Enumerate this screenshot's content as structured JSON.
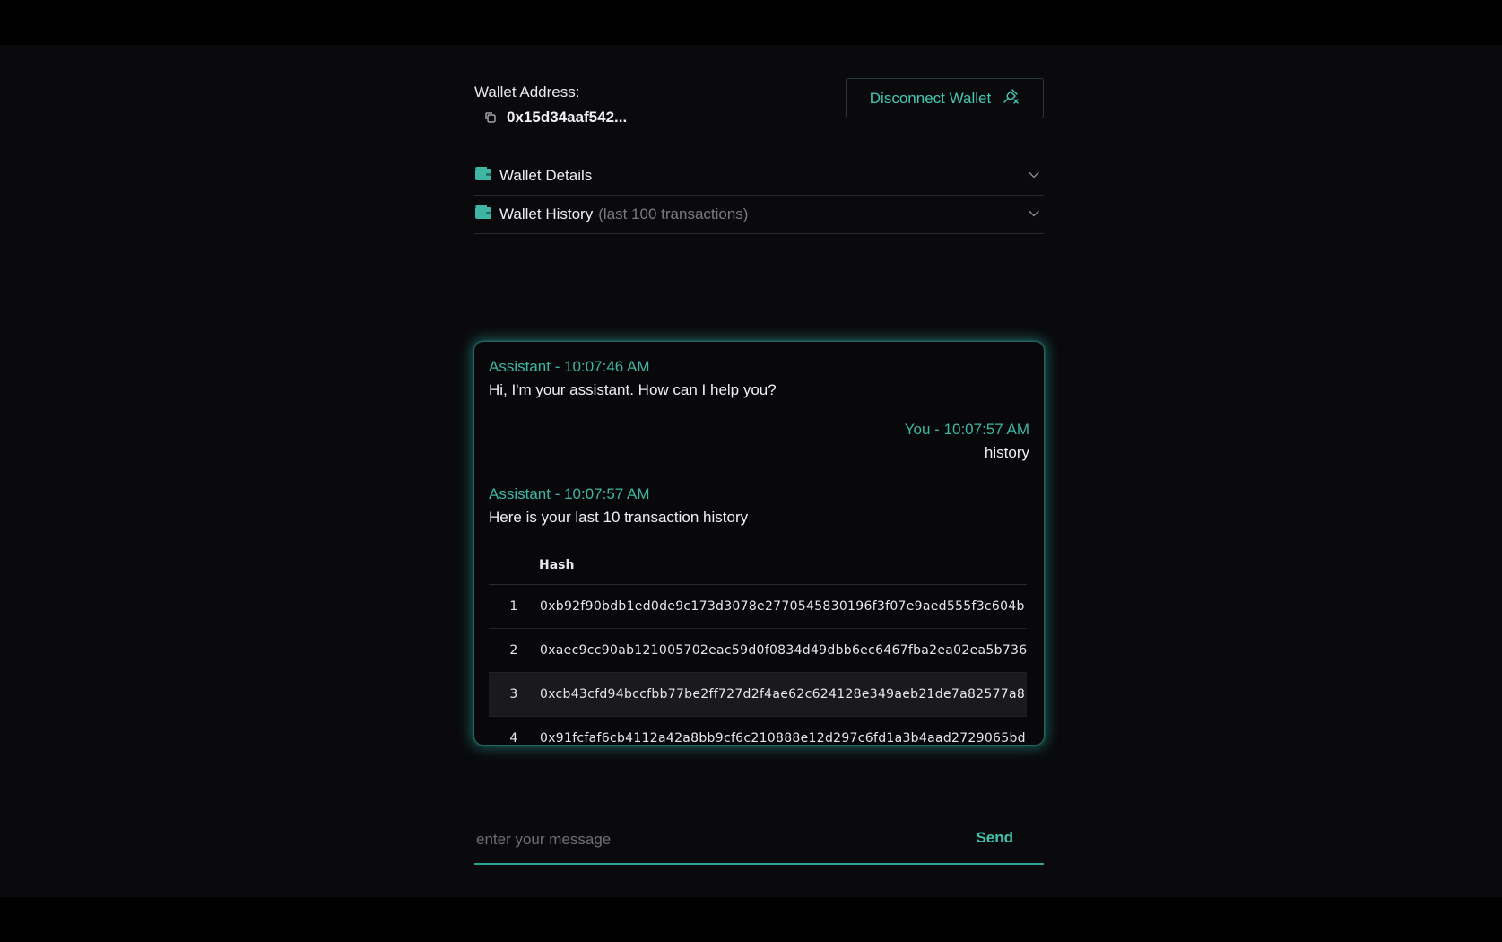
{
  "wallet": {
    "label": "Wallet Address:",
    "address": "0x15d34aaf542...",
    "disconnect_label": "Disconnect Wallet"
  },
  "accordion": {
    "details_title": "Wallet Details",
    "history_title": "Wallet History",
    "history_sub": "(last 100 transactions)"
  },
  "chat": {
    "messages": [
      {
        "meta": "Assistant - 10:07:46 AM",
        "body": "Hi, I'm your assistant. How can I help you?"
      },
      {
        "meta": "You - 10:07:57 AM",
        "body": "history"
      },
      {
        "meta": "Assistant - 10:07:57 AM",
        "body": "Here is your last 10 transaction history"
      }
    ],
    "table": {
      "header_hash": "Hash",
      "rows": [
        {
          "num": "1",
          "hash": "0xb92f90bdb1ed0de9c173d3078e2770545830196f3f07e9aed555f3c604b"
        },
        {
          "num": "2",
          "hash": "0xaec9cc90ab121005702eac59d0f0834d49dbb6ec6467fba2ea02ea5b736"
        },
        {
          "num": "3",
          "hash": "0xcb43cfd94bccfbb77be2ff727d2f4ae62c624128e349aeb21de7a82577a8"
        },
        {
          "num": "4",
          "hash": "0x91fcfaf6cb4112a42a8bb9cf6c210888e12d297c6fd1a3b4aad2729065bd"
        }
      ]
    }
  },
  "input": {
    "placeholder": "enter your message",
    "value": "",
    "send_label": "Send"
  },
  "icons": {
    "copy": "copy-icon",
    "disconnect": "plug-disconnect-icon",
    "folder": "wallet-folder-icon",
    "chevron": "chevron-down-icon"
  },
  "colors": {
    "accent": "#3fb5a3",
    "background": "#0a0a0c",
    "glow": "#2a9a8c"
  }
}
